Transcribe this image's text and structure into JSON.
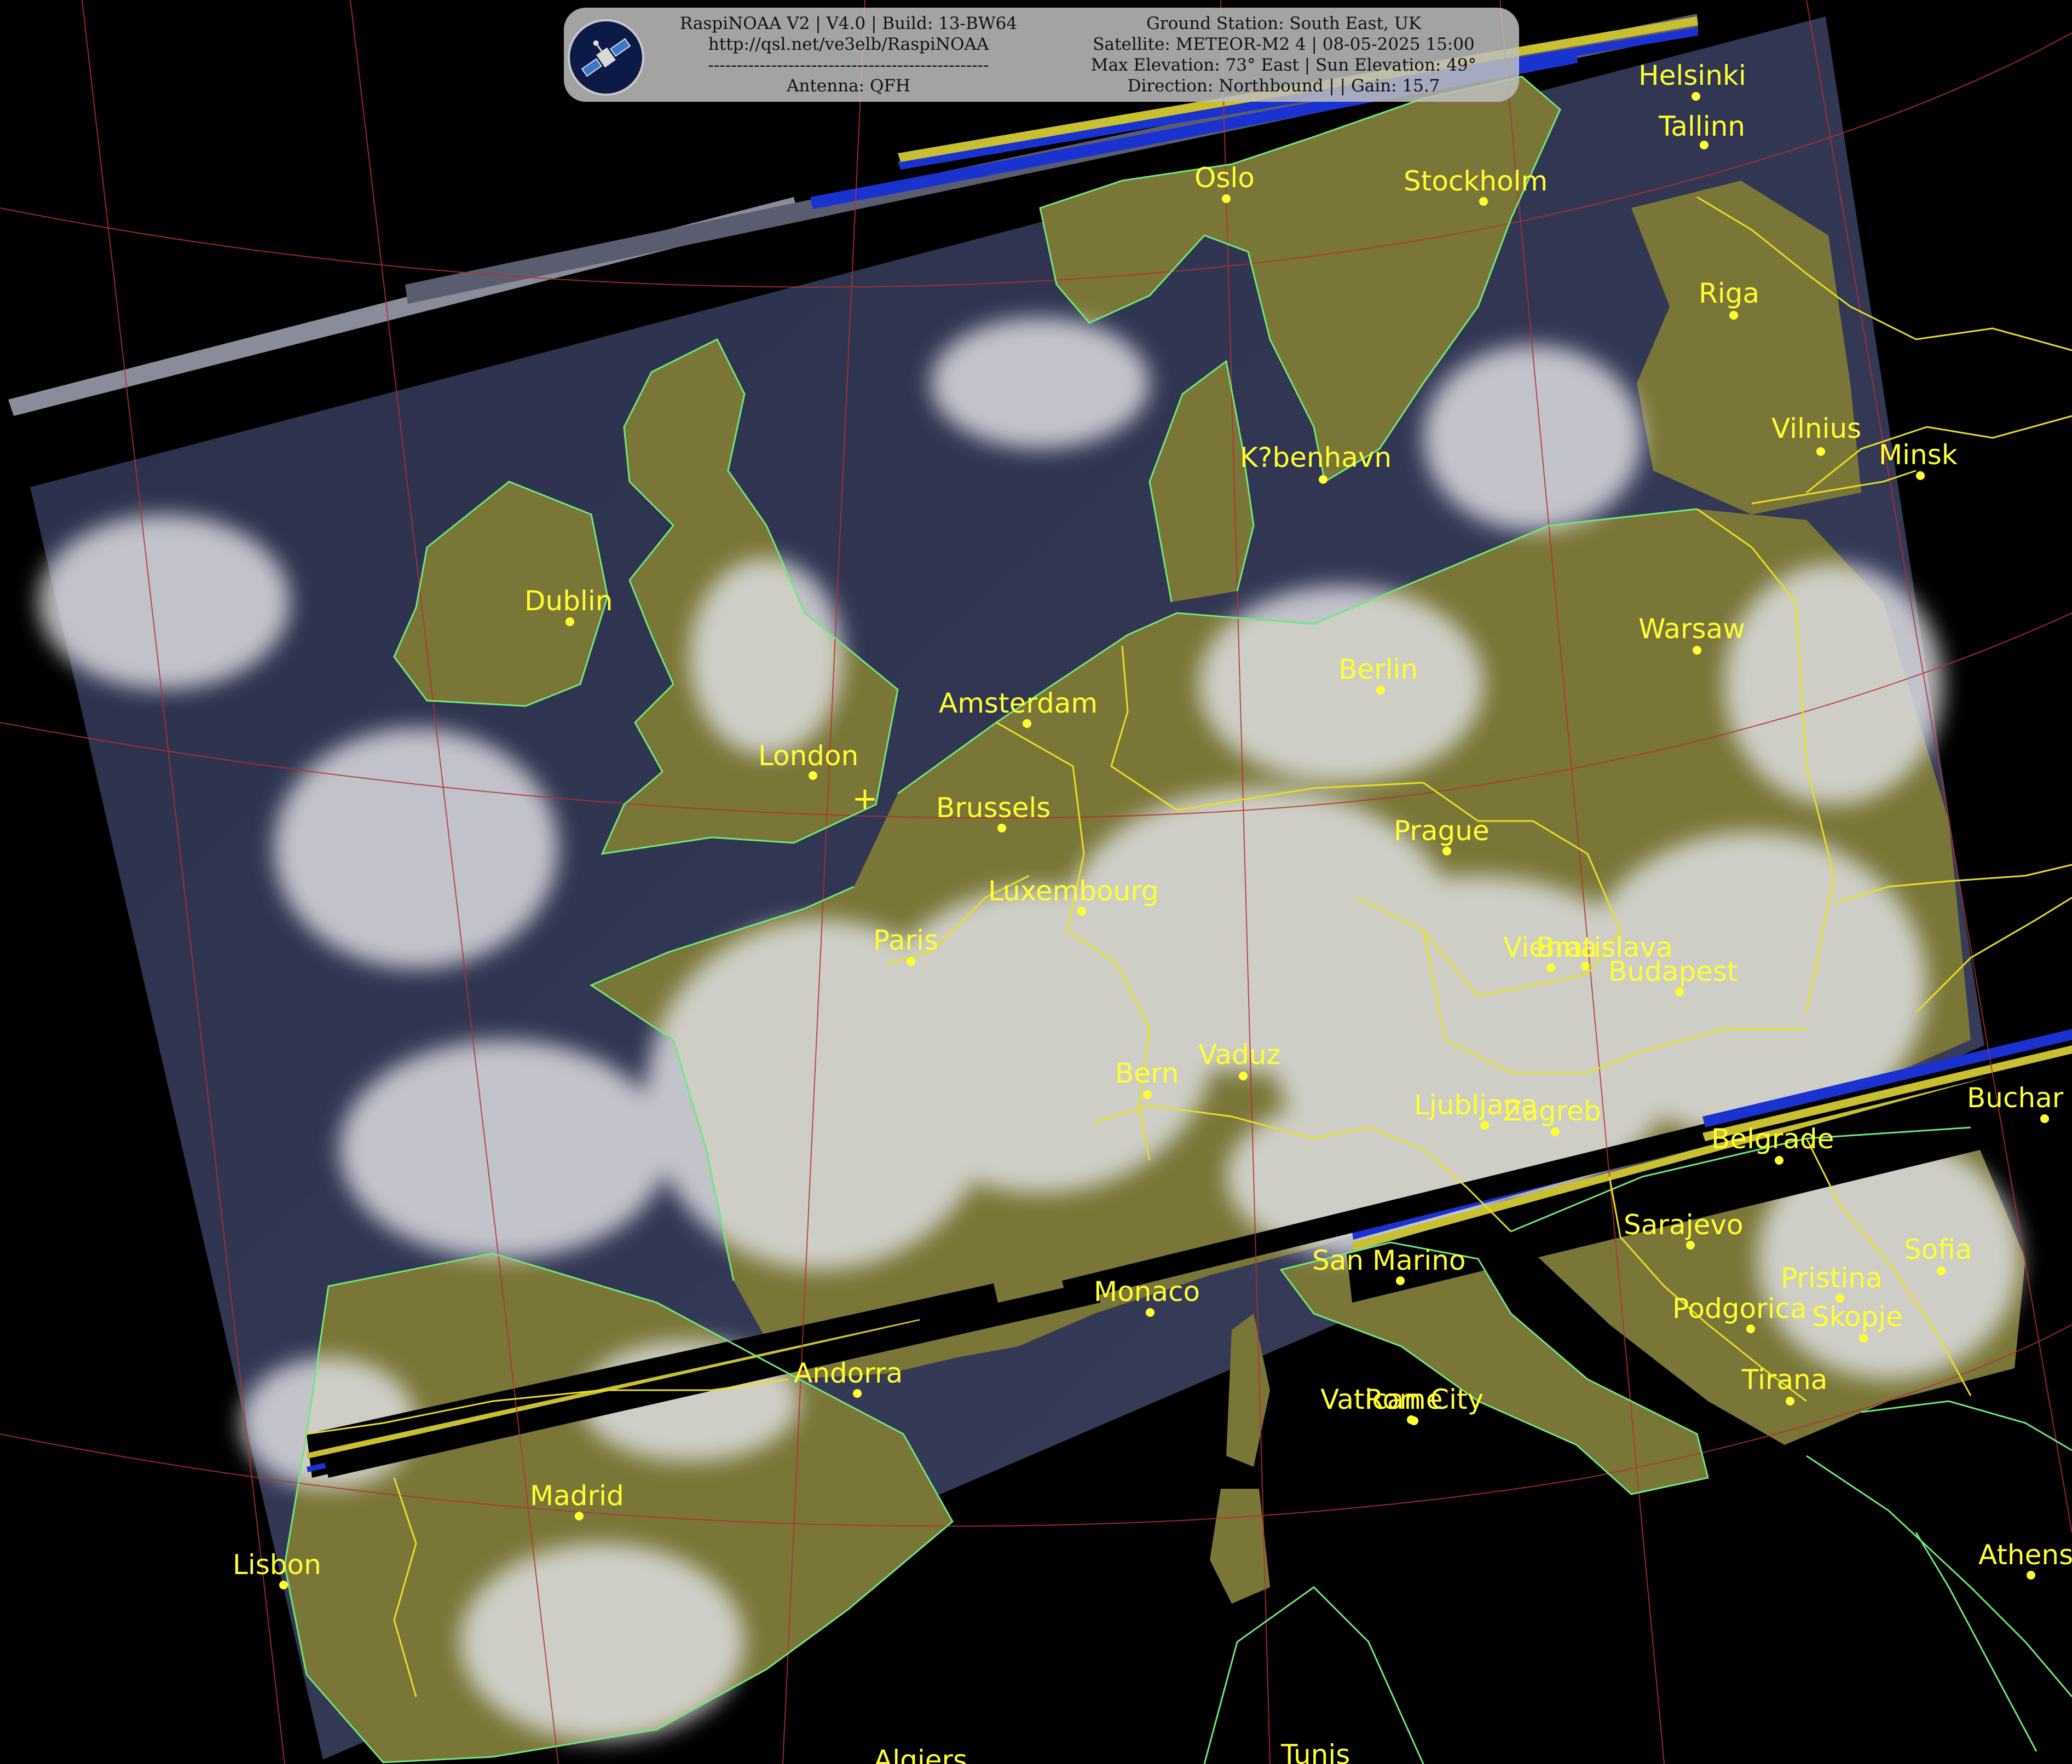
{
  "header": {
    "left_lines": [
      "RaspiNOAA V2 | V4.0 | Build: 13-BW64",
      "http://qsl.net/ve3elb/RaspiNOAA",
      "-------------------------------------------------",
      "Antenna: QFH"
    ],
    "right_lines": [
      "Ground Station: South East, UK",
      "Satellite: METEOR-M2 4 | 08-05-2025 15:00",
      "Max Elevation: 73° East | Sun Elevation: 49°",
      "Direction: Northbound | | Gain: 15.7"
    ]
  },
  "map": {
    "label_color": "#ffff33",
    "coast_color": "#6fe87a",
    "border_color": "#e8e020",
    "graticule_color": "#b43030",
    "ground_station_marker": "+",
    "cities": [
      {
        "name": "Helsinki"
      },
      {
        "name": "Tallinn"
      },
      {
        "name": "Oslo"
      },
      {
        "name": "Stockholm"
      },
      {
        "name": "Riga"
      },
      {
        "name": "Vilnius"
      },
      {
        "name": "Minsk"
      },
      {
        "name": "K?benhavn"
      },
      {
        "name": "Dublin"
      },
      {
        "name": "Warsaw"
      },
      {
        "name": "Berlin"
      },
      {
        "name": "Amsterdam"
      },
      {
        "name": "London"
      },
      {
        "name": "Brussels"
      },
      {
        "name": "Prague"
      },
      {
        "name": "Luxembourg"
      },
      {
        "name": "Paris"
      },
      {
        "name": "Vienna"
      },
      {
        "name": "Bratislava"
      },
      {
        "name": "Budapest"
      },
      {
        "name": "Bern"
      },
      {
        "name": "Vaduz"
      },
      {
        "name": "Ljubljana"
      },
      {
        "name": "Zagreb"
      },
      {
        "name": "Buchar"
      },
      {
        "name": "Belgrade"
      },
      {
        "name": "Sarajevo"
      },
      {
        "name": "Sofia"
      },
      {
        "name": "San Marino"
      },
      {
        "name": "Monaco"
      },
      {
        "name": "Pristina"
      },
      {
        "name": "Podgorica"
      },
      {
        "name": "Skopje"
      },
      {
        "name": "Andorra"
      },
      {
        "name": "Tirana"
      },
      {
        "name": "Vatican City"
      },
      {
        "name": "Rome"
      },
      {
        "name": "Madrid"
      },
      {
        "name": "Lisbon"
      },
      {
        "name": "Athens"
      },
      {
        "name": "Algiers"
      },
      {
        "name": "Tunis"
      }
    ]
  }
}
